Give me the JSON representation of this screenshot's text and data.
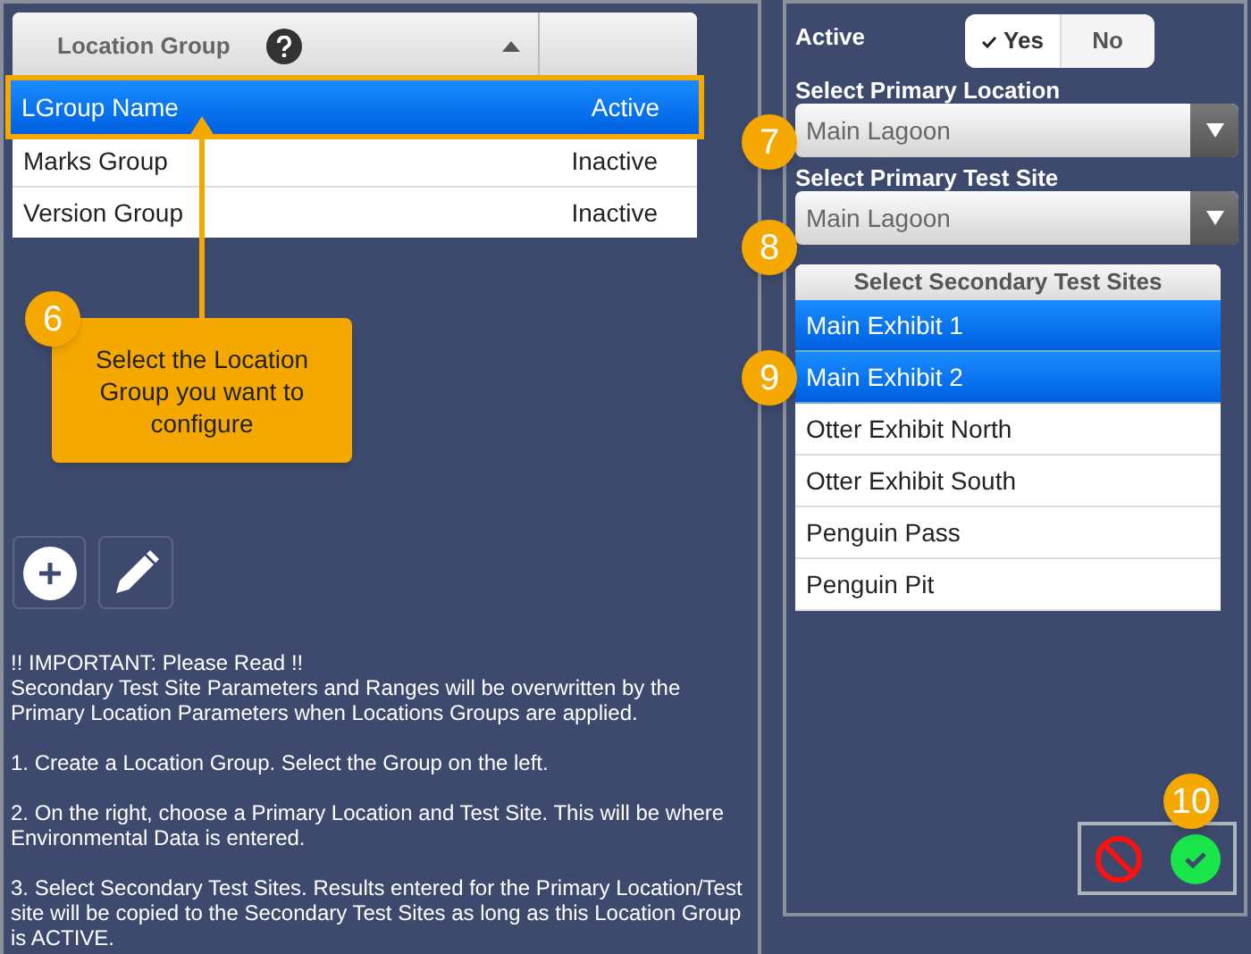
{
  "location_groups": {
    "columns": [
      {
        "label": "Location Group",
        "sorted_ascending": true
      }
    ],
    "rows": [
      {
        "name": "LGroup Name",
        "status": "Active",
        "selected": true
      },
      {
        "name": "Marks Group",
        "status": "Inactive",
        "selected": false
      },
      {
        "name": "Version Group",
        "status": "Inactive",
        "selected": false
      }
    ]
  },
  "notes": [
    "!! IMPORTANT: Please Read !!\nSecondary Test Site Parameters and Ranges will be overwritten by the Primary Location Parameters when Locations Groups are applied.",
    "1. Create a Location Group. Select the Group on the left.",
    "2. On the right, choose a Primary Location and Test Site. This will be where Environmental Data is entered.",
    "3. Select Secondary Test Sites. Results entered for the Primary Location/Test site will be copied to the Secondary Test Sites as long as this Location Group is ACTIVE."
  ],
  "active": {
    "label": "Active",
    "options": [
      {
        "label": "Yes",
        "selected": true
      },
      {
        "label": "No",
        "selected": false
      }
    ]
  },
  "primary_location": {
    "label": "Select Primary Location",
    "value": "Main Lagoon"
  },
  "primary_test_site": {
    "label": "Select Primary Test Site",
    "value": "Main Lagoon"
  },
  "secondary_test_sites": {
    "header": "Select Secondary Test Sites",
    "items": [
      {
        "label": "Main Exhibit 1",
        "selected": true
      },
      {
        "label": "Main Exhibit 2",
        "selected": true
      },
      {
        "label": "Otter Exhibit North",
        "selected": false
      },
      {
        "label": "Otter Exhibit South",
        "selected": false
      },
      {
        "label": "Penguin Pass",
        "selected": false
      },
      {
        "label": "Penguin Pit",
        "selected": false
      }
    ]
  },
  "callouts": [
    {
      "number": "6",
      "text": "Select the Location Group you want to configure"
    },
    {
      "number": "7"
    },
    {
      "number": "8"
    },
    {
      "number": "9"
    },
    {
      "number": "10"
    }
  ]
}
